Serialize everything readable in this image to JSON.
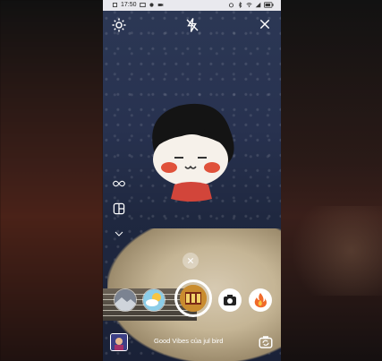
{
  "status_bar": {
    "time": "17:50",
    "battery_text": ""
  },
  "top_bar": {
    "settings_icon": "gear-icon",
    "flash_icon": "flash-off-icon",
    "close_icon": "close-icon"
  },
  "side_tools": [
    "infinity-icon",
    "layout-icon",
    "chevron-down-icon"
  ],
  "filters": {
    "items": [
      {
        "name": "photo-filter-thumb"
      },
      {
        "name": "weather-filter-thumb"
      },
      {
        "name": "film-filter-thumb-selected"
      },
      {
        "name": "camera-filter-thumb"
      },
      {
        "name": "fire-filter-thumb"
      }
    ]
  },
  "bottom_bar": {
    "caption": "Good Vibes của jul bird"
  },
  "colors": {
    "accent": "#c98c2f",
    "status_bar_bg": "#e9e9ee"
  }
}
